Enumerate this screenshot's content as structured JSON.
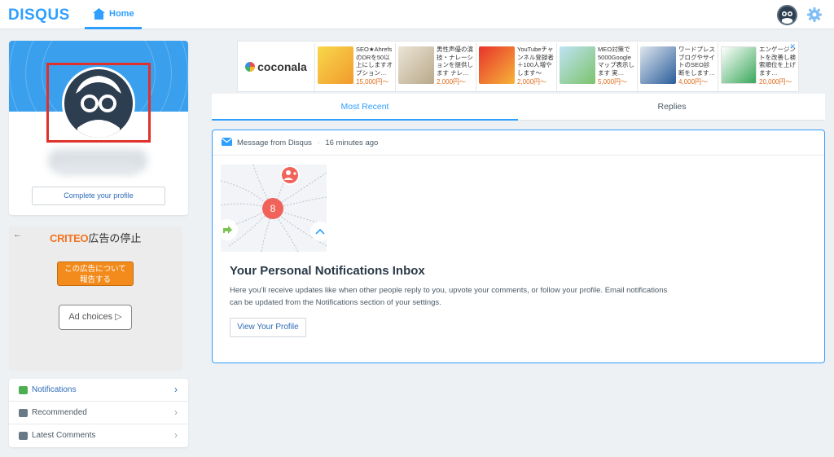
{
  "nav": {
    "logo": "DISQUS",
    "home_label": "Home"
  },
  "profile": {
    "complete_label": "Complete your profile"
  },
  "criteo_ad": {
    "back": "←",
    "brand": "CRITEO",
    "title_suffix": "広告の停止",
    "report_line1": "この広告について",
    "report_line2": "報告する",
    "adchoices": "Ad choices ▷"
  },
  "menu": {
    "items": [
      {
        "label": "Notifications",
        "chevron": "›"
      },
      {
        "label": "Recommended",
        "chevron": "›"
      },
      {
        "label": "Latest Comments",
        "chevron": "›"
      }
    ]
  },
  "ad_banner": {
    "brand": "coconala",
    "close": "✕",
    "items": [
      {
        "text": "SEO★Ahrefs のDRを50以上にしますオプション…",
        "price": "15,000円〜"
      },
      {
        "text": "男性声優の演技・ナレーションを提供します ナレ…",
        "price": "2,000円〜"
      },
      {
        "text": "YouTubeチャンネル登録者＋100人増やします～",
        "price": "2,000円〜"
      },
      {
        "text": "MEO対策で5000Googleマップ表示します 実…",
        "price": "5,000円〜"
      },
      {
        "text": "ワードプレスブログやサイトのSEO診断をします…",
        "price": "4,000円〜"
      },
      {
        "text": "エンゲージントを改善し検索順位を上げます…",
        "price": "20,000円〜"
      }
    ]
  },
  "tabs": [
    {
      "label": "Most Recent"
    },
    {
      "label": "Replies"
    }
  ],
  "message": {
    "from": "Message from Disqus",
    "separator": "·",
    "time": "16 minutes ago",
    "badge_count": "8",
    "title": "Your Personal Notifications Inbox",
    "body": "Here you'll receive updates like when other people reply to you, upvote your comments, or follow your profile. Email notifications can be updated from the Notifications section of your settings.",
    "button": "View Your Profile"
  },
  "colors": {
    "accent": "#2e9fff",
    "highlight": "#e0302a",
    "report_orange": "#f28b1c"
  }
}
